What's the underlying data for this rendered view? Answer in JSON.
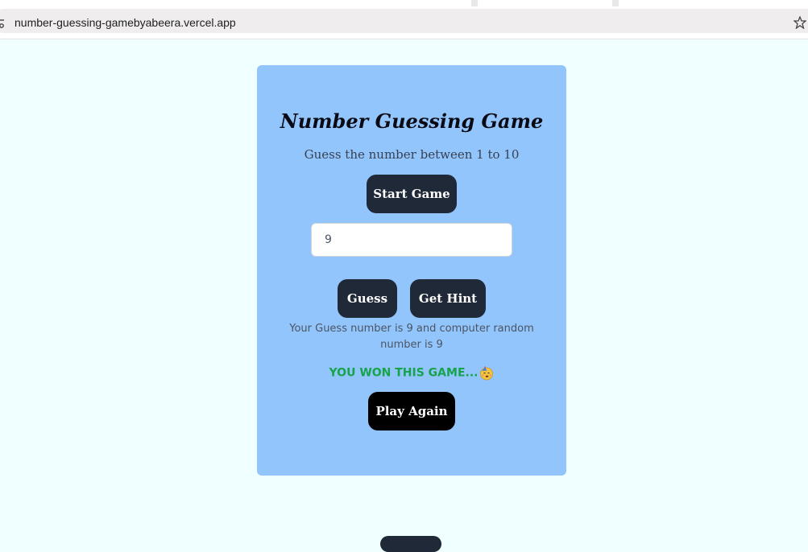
{
  "browser": {
    "url": "number-guessing-gamebyabeera.vercel.app",
    "icons": [
      "site-info-icon",
      "star-icon"
    ]
  },
  "game": {
    "title": "Number Guessing Game",
    "subtitle": "Guess the number between 1 to 10",
    "start_label": "Start Game",
    "input_value": "9",
    "guess_label": "Guess",
    "hint_label": "Get Hint",
    "result_message": "Your Guess number is 9 and computer random number is 9",
    "win_message": "YOU WON THIS GAME...",
    "win_icon": "celebrate-emoji-icon",
    "play_again_label": "Play Again"
  },
  "colors": {
    "page_bg": "#f0ffff",
    "card_bg": "#93c5fd",
    "button_dark": "#1f2937",
    "button_black": "#000000",
    "win_green": "#16a34a"
  }
}
